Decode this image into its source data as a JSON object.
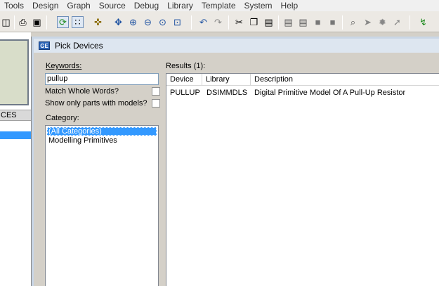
{
  "menu": [
    "Tools",
    "Design",
    "Graph",
    "Source",
    "Debug",
    "Library",
    "Template",
    "System",
    "Help"
  ],
  "left_pane": {
    "header": "CES"
  },
  "dialog": {
    "title": "Pick Devices",
    "app_icon_text": "GE",
    "keywords_label": "Keywords:",
    "keywords_value": "pullup",
    "match_whole_words_label": "Match Whole Words?",
    "match_whole_words_checked": false,
    "show_models_label": "Show only parts with models?",
    "show_models_checked": false,
    "category_label": "Category:",
    "categories": [
      "(All Categories)",
      "Modelling Primitives"
    ],
    "selected_category": "(All Categories)",
    "results_label": "Results (1):",
    "results_columns": [
      "Device",
      "Library",
      "Description"
    ],
    "results_rows": [
      {
        "device": "PULLUP",
        "library": "DSIMMDLS",
        "description": "Digital Primitive Model Of A Pull-Up Resistor"
      }
    ]
  },
  "toolbar_icons": [
    "netlist-icon",
    "print-icon",
    "print-area-icon",
    "refresh-icon",
    "grid-icon",
    "origin-icon",
    "pan-icon",
    "zoom-in-icon",
    "zoom-out-icon",
    "zoom-all-icon",
    "zoom-area-icon",
    "undo-icon",
    "redo-icon",
    "cut-icon",
    "copy-icon",
    "paste-icon",
    "block-copy-icon",
    "block-move-icon",
    "block-rotate-icon",
    "block-delete-icon",
    "pick-device-icon",
    "make-device-icon",
    "package-tool-icon",
    "decompose-icon",
    "design-explorer-icon"
  ]
}
